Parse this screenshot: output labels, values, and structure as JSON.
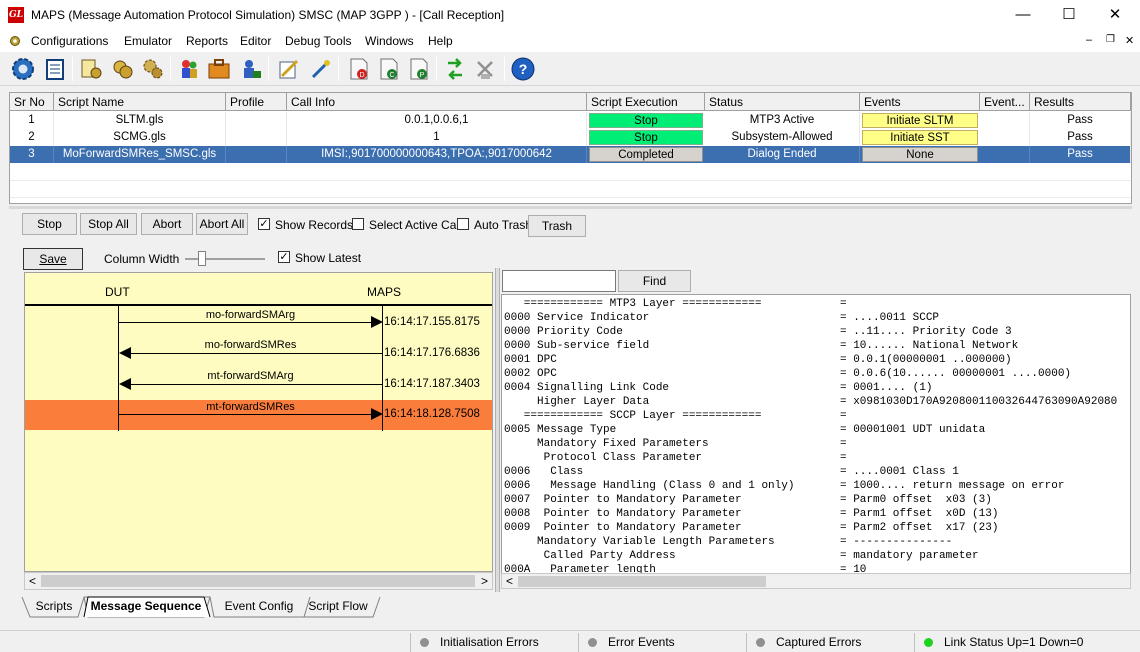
{
  "window": {
    "title": "MAPS (Message Automation Protocol Simulation) SMSC (MAP 3GPP ) - [Call Reception]",
    "logo_text": "GL",
    "min_glyph": "—",
    "max_glyph": "☐",
    "close_glyph": "✕",
    "child_min_glyph": "–",
    "child_restore_glyph": "❐",
    "child_close_glyph": "✕"
  },
  "menu": [
    "Configurations",
    "Emulator",
    "Reports",
    "Editor",
    "Debug Tools",
    "Windows",
    "Help"
  ],
  "toolbar_icons": [
    "gear-settings-icon",
    "notepad-icon",
    "script-edit-icon",
    "coins-icon",
    "gears-icon",
    "users-icon",
    "briefcase-icon",
    "user-lock-icon",
    "pen-check-icon",
    "wizard-icon",
    "doc-d-icon",
    "doc-c-icon",
    "doc-p-icon",
    "transfer-icon",
    "disconnect-icon",
    "help-icon"
  ],
  "grid": {
    "columns": [
      "Sr No",
      "Script Name",
      "Profile",
      "Call Info",
      "Script Execution",
      "Status",
      "Events",
      "Event...",
      "Results"
    ],
    "rows": [
      {
        "sr": "1",
        "script": "SLTM.gls",
        "profile": "",
        "call_info": "0.0.1,0.0.6,1",
        "execution": "Stop",
        "status": "MTP3 Active",
        "events": "Initiate SLTM",
        "event2": "",
        "result": "Pass"
      },
      {
        "sr": "2",
        "script": "SCMG.gls",
        "profile": "",
        "call_info": "1",
        "execution": "Stop",
        "status": "Subsystem-Allowed",
        "events": "Initiate SST",
        "event2": "",
        "result": "Pass"
      },
      {
        "sr": "3",
        "script": "MoForwardSMRes_SMSC.gls",
        "profile": "",
        "call_info": "IMSI:,901700000000643,TPOA:,9017000642",
        "execution": "Completed",
        "status": "Dialog Ended",
        "events": "None",
        "event2": "",
        "result": "Pass"
      }
    ],
    "colors": {
      "exec_green": "#00ee76",
      "event_yellow": "#ffff88",
      "selected": "#3c6fb0",
      "completed_grey": "#d6d3ce"
    }
  },
  "controls": {
    "stop": "Stop",
    "stop_all": "Stop All",
    "abort": "Abort",
    "abort_all": "Abort All",
    "show_records": "Show Records",
    "show_records_checked": true,
    "select_active_call": "Select Active Call",
    "auto_trash": "Auto Trash",
    "trash": "Trash"
  },
  "sequence_controls": {
    "save": "Save",
    "column_width": "Column Width",
    "show_latest": "Show Latest"
  },
  "sequence": {
    "left_entity": "DUT",
    "right_entity": "MAPS",
    "messages": [
      {
        "label": "mo-forwardSMArg",
        "time": "16:14:17.155.8175",
        "direction": "right",
        "highlight": false
      },
      {
        "label": "mo-forwardSMRes",
        "time": "16:14:17.176.6836",
        "direction": "left",
        "highlight": false
      },
      {
        "label": "mt-forwardSMArg",
        "time": "16:14:17.187.3403",
        "direction": "left",
        "highlight": false
      },
      {
        "label": "mt-forwardSMRes",
        "time": "16:14:18.128.7508",
        "direction": "right",
        "highlight": true
      }
    ],
    "highlight_color": "#fa7d3c",
    "scroll_left_glyph": "<",
    "scroll_right_glyph": ">"
  },
  "find": {
    "button": "Find",
    "value": ""
  },
  "decode": [
    {
      "l": "   ============ MTP3 Layer ============",
      "r": "="
    },
    {
      "l": "0000 Service Indicator",
      "r": "= ....0011 SCCP"
    },
    {
      "l": "0000 Priority Code",
      "r": "= ..11.... Priority Code 3"
    },
    {
      "l": "0000 Sub-service field",
      "r": "= 10...... National Network"
    },
    {
      "l": "0001 DPC",
      "r": "= 0.0.1(00000001 ..000000)"
    },
    {
      "l": "0002 OPC",
      "r": "= 0.0.6(10...... 00000001 ....0000)"
    },
    {
      "l": "0004 Signalling Link Code",
      "r": "= 0001.... (1)"
    },
    {
      "l": "     Higher Layer Data",
      "r": "= x0981030D170A920800110032644763090A92080"
    },
    {
      "l": "   ============ SCCP Layer ============",
      "r": "="
    },
    {
      "l": "0005 Message Type",
      "r": "= 00001001 UDT unidata"
    },
    {
      "l": "     Mandatory Fixed Parameters",
      "r": "="
    },
    {
      "l": "      Protocol Class Parameter",
      "r": "="
    },
    {
      "l": "0006   Class",
      "r": "= ....0001 Class 1"
    },
    {
      "l": "0006   Message Handling (Class 0 and 1 only)",
      "r": "= 1000.... return message on error"
    },
    {
      "l": "0007  Pointer to Mandatory Parameter",
      "r": "= Parm0 offset  x03 (3)"
    },
    {
      "l": "0008  Pointer to Mandatory Parameter",
      "r": "= Parm1 offset  x0D (13)"
    },
    {
      "l": "0009  Pointer to Mandatory Parameter",
      "r": "= Parm2 offset  x17 (23)"
    },
    {
      "l": "     Mandatory Variable Length Parameters",
      "r": "= ---------------"
    },
    {
      "l": "      Called Party Address",
      "r": "= mandatory parameter"
    },
    {
      "l": "000A   Parameter length",
      "r": "= 10"
    }
  ],
  "tabs": [
    "Scripts",
    "Message Sequence",
    "Event Config",
    "Script Flow"
  ],
  "active_tab": "Message Sequence",
  "statusbar": [
    {
      "label": "Initialisation Errors",
      "color": "#909090"
    },
    {
      "label": "Error Events",
      "color": "#909090"
    },
    {
      "label": "Captured Errors",
      "color": "#909090"
    },
    {
      "label": "Link Status Up=1 Down=0",
      "color": "#1ed21e"
    }
  ]
}
